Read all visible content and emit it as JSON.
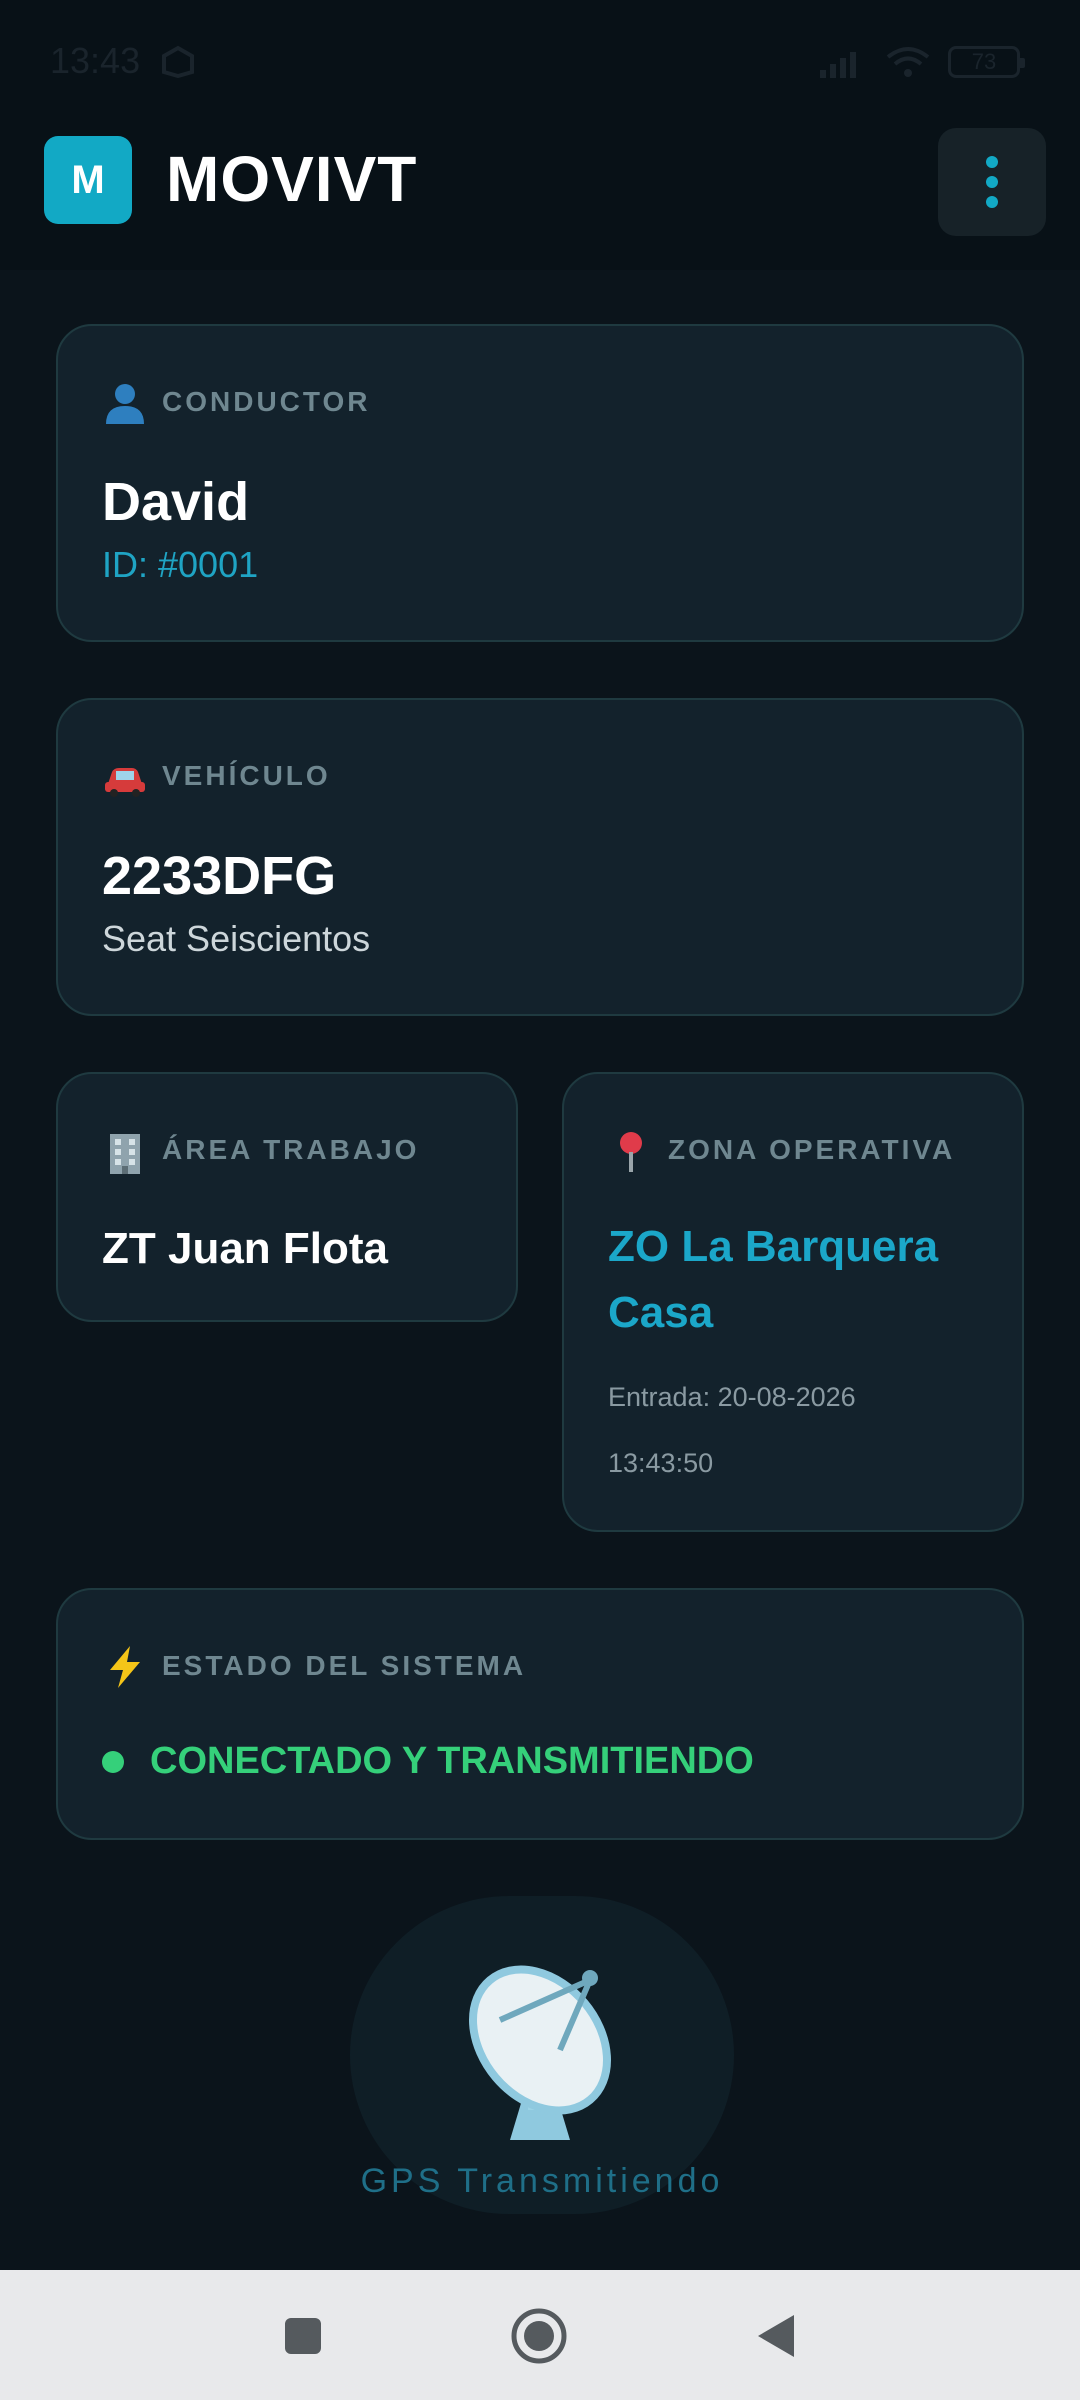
{
  "status_bar": {
    "time": "13:43",
    "battery": "73"
  },
  "header": {
    "logo_letter": "M",
    "title": "MOVIVT"
  },
  "driver": {
    "label": "CONDUCTOR",
    "name": "David",
    "id": "ID: #0001"
  },
  "vehicle": {
    "label": "VEHÍCULO",
    "plate": "2233DFG",
    "model": "Seat Seiscientos"
  },
  "work_area": {
    "label": "ÁREA TRABAJO",
    "value": "ZT Juan Flota"
  },
  "zone": {
    "label": "ZONA OPERATIVA",
    "name": "ZO La Barquera Casa",
    "entry": "Entrada: 20-08-2026 13:43:50"
  },
  "system": {
    "label": "ESTADO DEL SISTEMA",
    "status": "CONECTADO Y TRANSMITIENDO"
  },
  "gps": {
    "label": "GPS Transmitiendo"
  },
  "colors": {
    "accent": "#12a9c5",
    "background": "#0b141b",
    "card": "#13222c",
    "success": "#35d07a"
  }
}
